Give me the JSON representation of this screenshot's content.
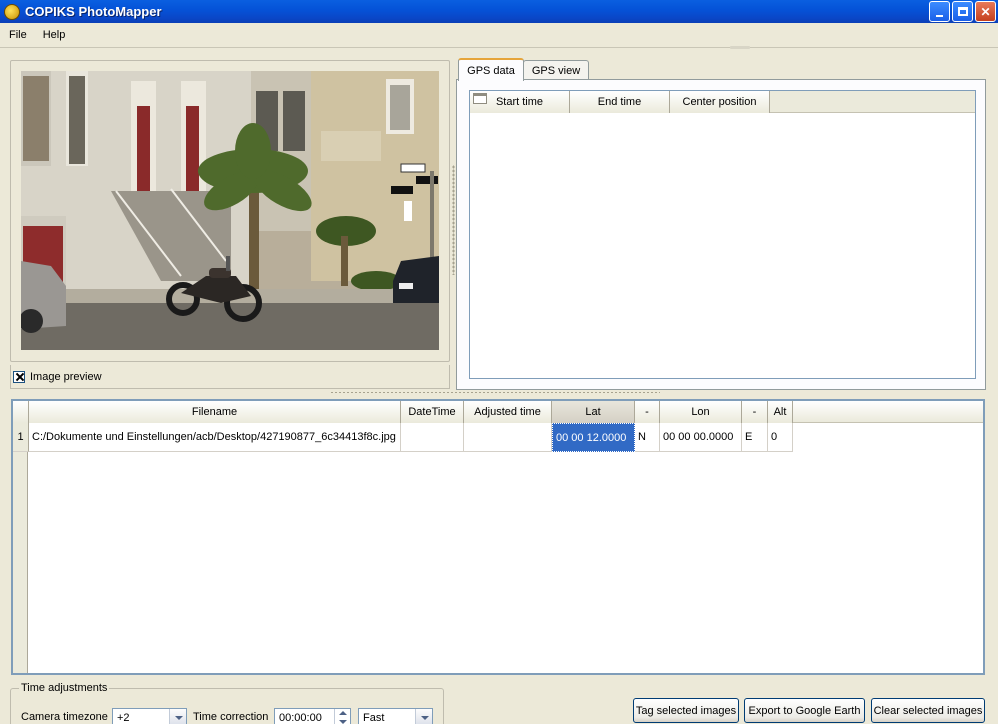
{
  "window": {
    "title": "COPIKS PhotoMapper"
  },
  "menu": {
    "items": [
      "File",
      "Help"
    ]
  },
  "preview": {
    "checkbox_label": "Image preview",
    "checked": true
  },
  "tabs": [
    {
      "label": "GPS data",
      "active": true
    },
    {
      "label": "GPS view",
      "active": false
    }
  ],
  "gps_table": {
    "columns": [
      "Start time",
      "End time",
      "Center position"
    ]
  },
  "images_table": {
    "columns": [
      "Filename",
      "DateTime",
      "Adjusted time",
      "Lat",
      "-",
      "Lon",
      "-",
      "Alt"
    ],
    "rows": [
      {
        "num": "1",
        "filename": "C:/Dokumente und Einstellungen/acb/Desktop/427190877_6c34413f8c.jpg",
        "datetime": "",
        "adjusted_time": "",
        "lat": "00 00 12.0000",
        "lat_dir": "N",
        "lon": "00 00 00.0000",
        "lon_dir": "E",
        "alt": "0"
      }
    ]
  },
  "time_adjustments": {
    "title": "Time adjustments",
    "camera_timezone_label": "Camera timezone",
    "camera_timezone_value": "+2",
    "time_correction_label": "Time correction",
    "time_correction_value": "00:00:00",
    "speed_value": "Fast"
  },
  "buttons": {
    "tag": "Tag selected images",
    "export": "Export to Google Earth",
    "clear": "Clear selected images"
  },
  "colors": {
    "titlebar": "#0553d8",
    "selection": "#316ac5",
    "tab_highlight": "#e6a53b"
  }
}
